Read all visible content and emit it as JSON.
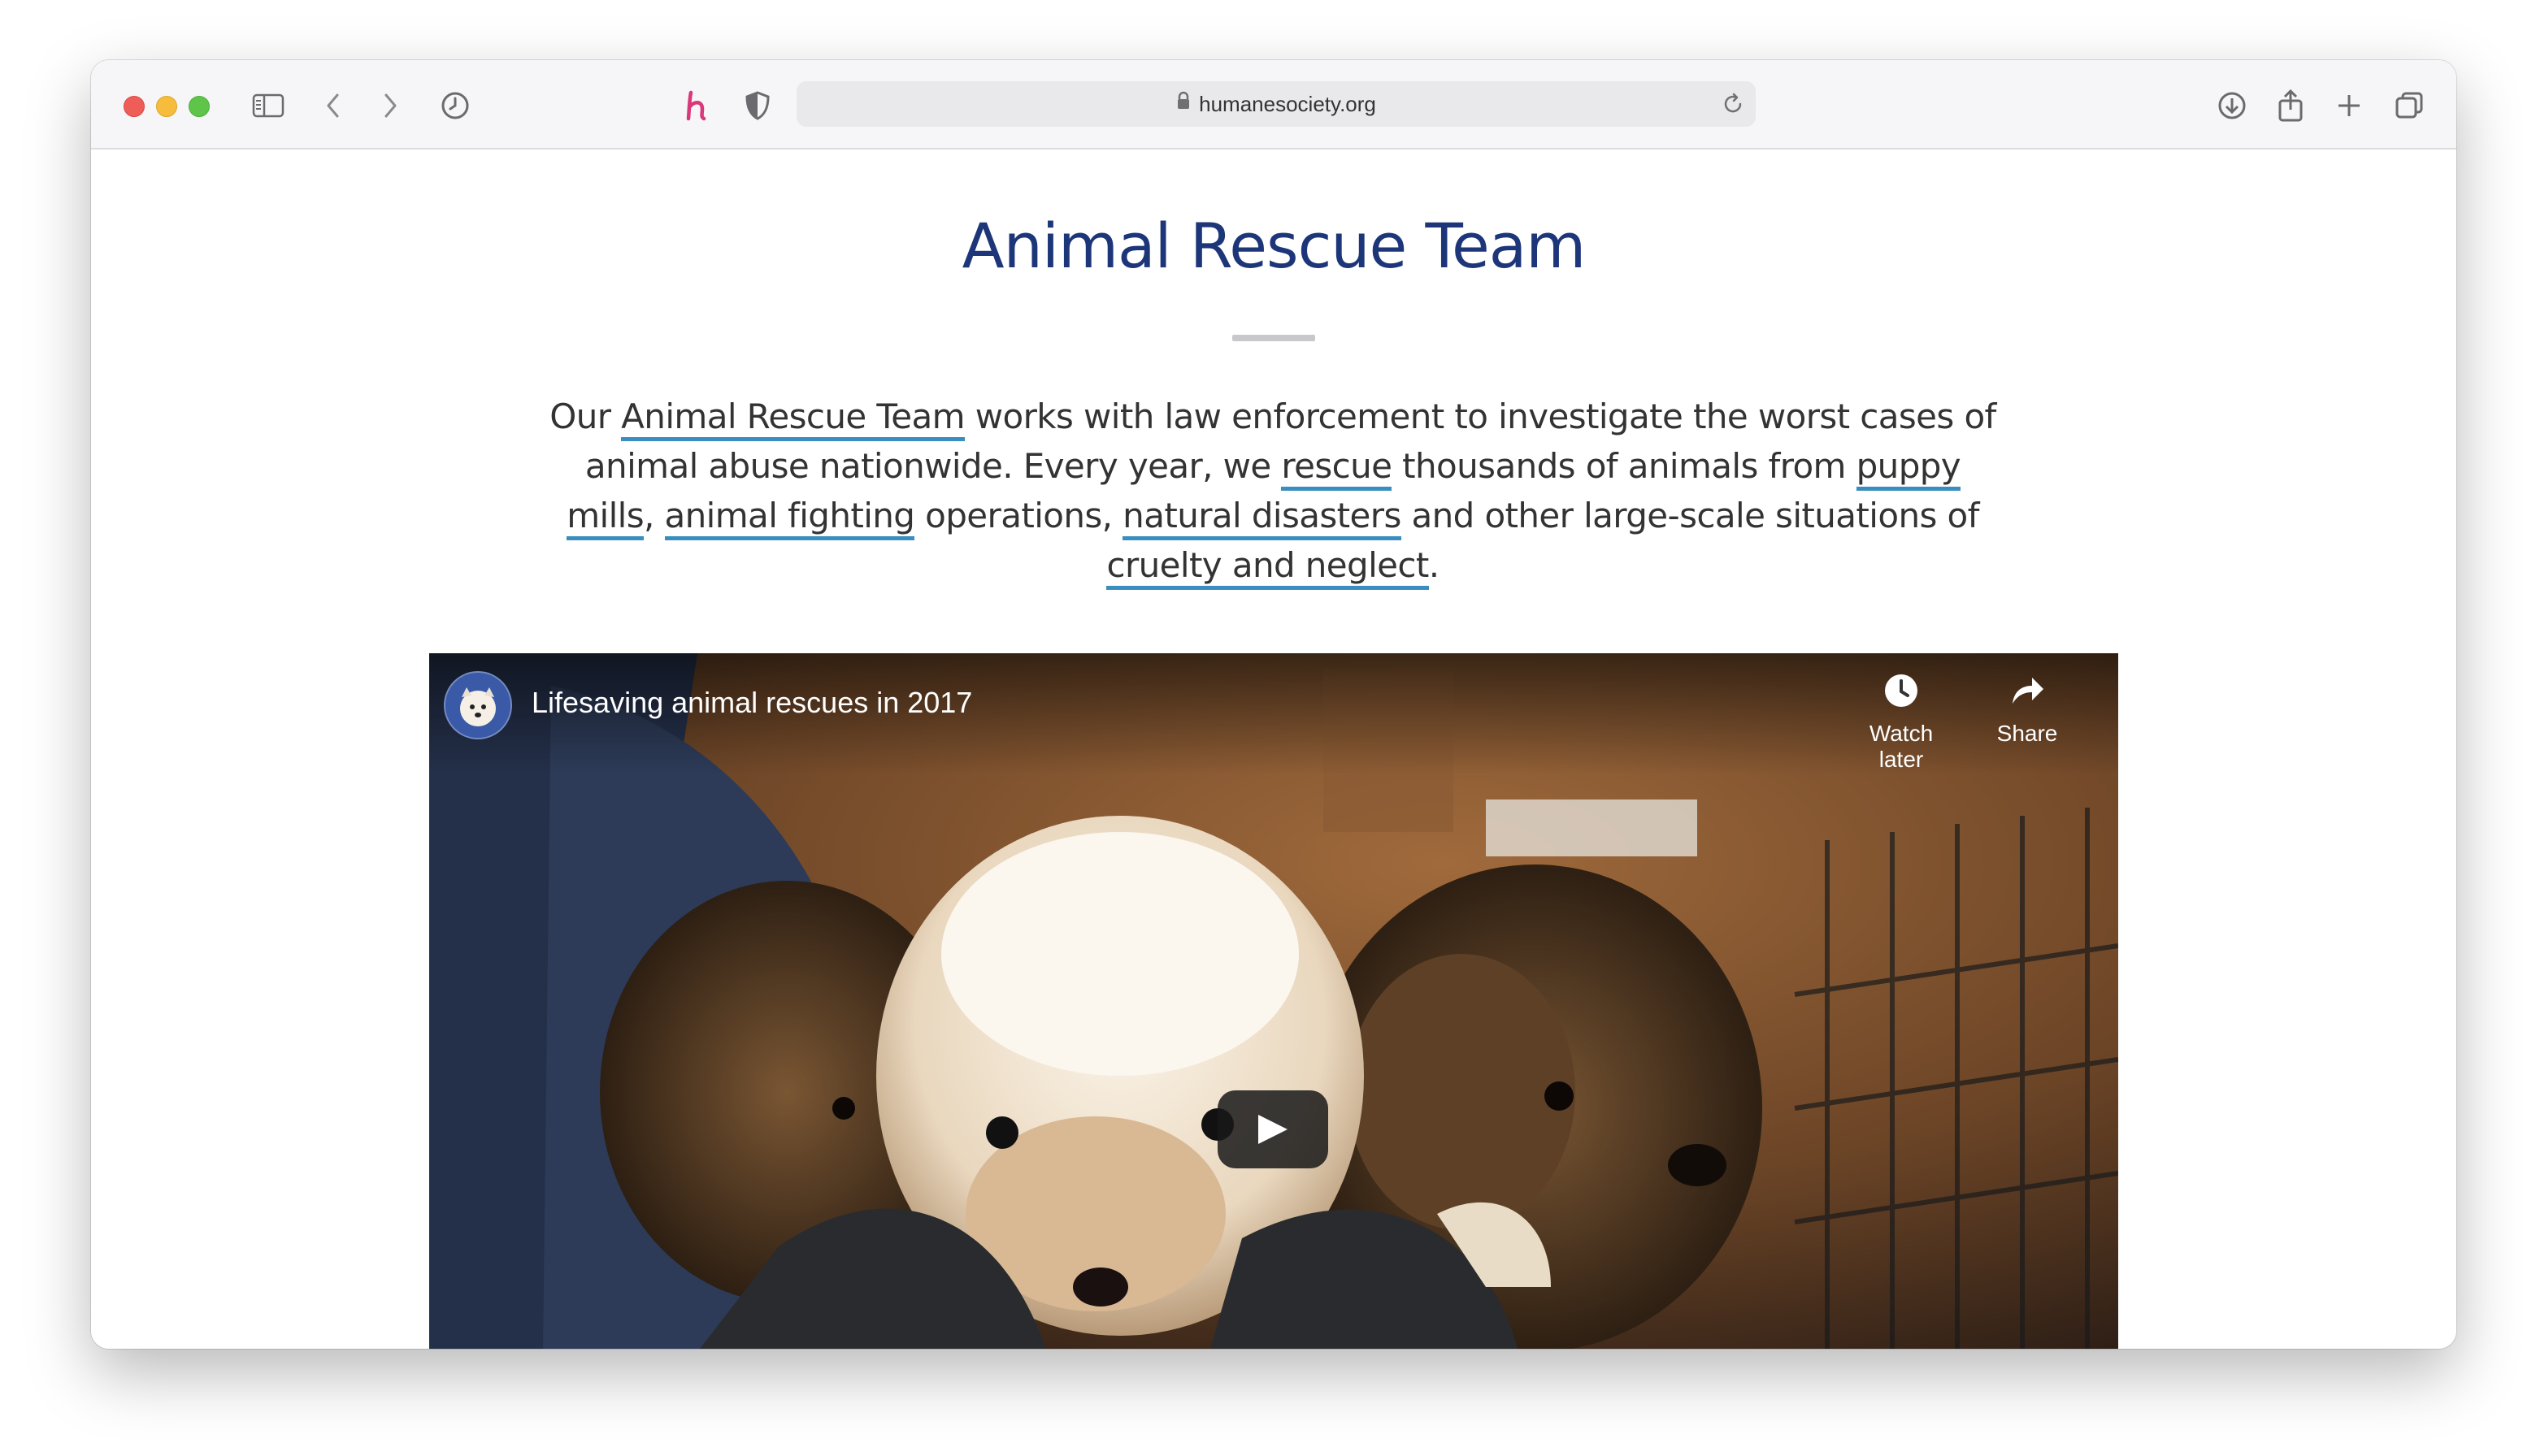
{
  "browser": {
    "url": "humanesociety.org",
    "icons": [
      "sidebar-icon",
      "back-chevron-icon",
      "forward-chevron-icon",
      "history-clock-icon",
      "honey-extension-icon",
      "privacy-shield-icon",
      "lock-icon",
      "reload-icon",
      "download-icon",
      "share-icon",
      "new-tab-plus-icon",
      "tab-overview-icon"
    ],
    "colors": {
      "close": "#ee5d57",
      "minimize": "#f6bd3c",
      "zoom": "#5fc54a",
      "honey": "#d9387a"
    }
  },
  "page": {
    "title": "Animal Rescue Team",
    "title_color": "#1d3679",
    "link_underline_color": "#3a8dbf",
    "intro": {
      "t1": "Our ",
      "link1": "Animal Rescue Team",
      "t2": " works with law enforcement to investigate the worst cases of animal abuse nationwide. Every year, we ",
      "link2": "rescue",
      "t3": " thousands of animals from ",
      "link3": "puppy mills",
      "t4": ", ",
      "link4": "animal fighting",
      "t5": " operations, ",
      "link5": "natural disasters",
      "t6": " and other large-scale situations of ",
      "link6": "cruelty and neglect",
      "t7": "."
    }
  },
  "video": {
    "title": "Lifesaving animal rescues in 2017",
    "watch_later": "Watch later",
    "share": "Share",
    "icons": [
      "channel-avatar",
      "watch-later-clock-icon",
      "share-arrow-icon",
      "play-icon"
    ]
  }
}
